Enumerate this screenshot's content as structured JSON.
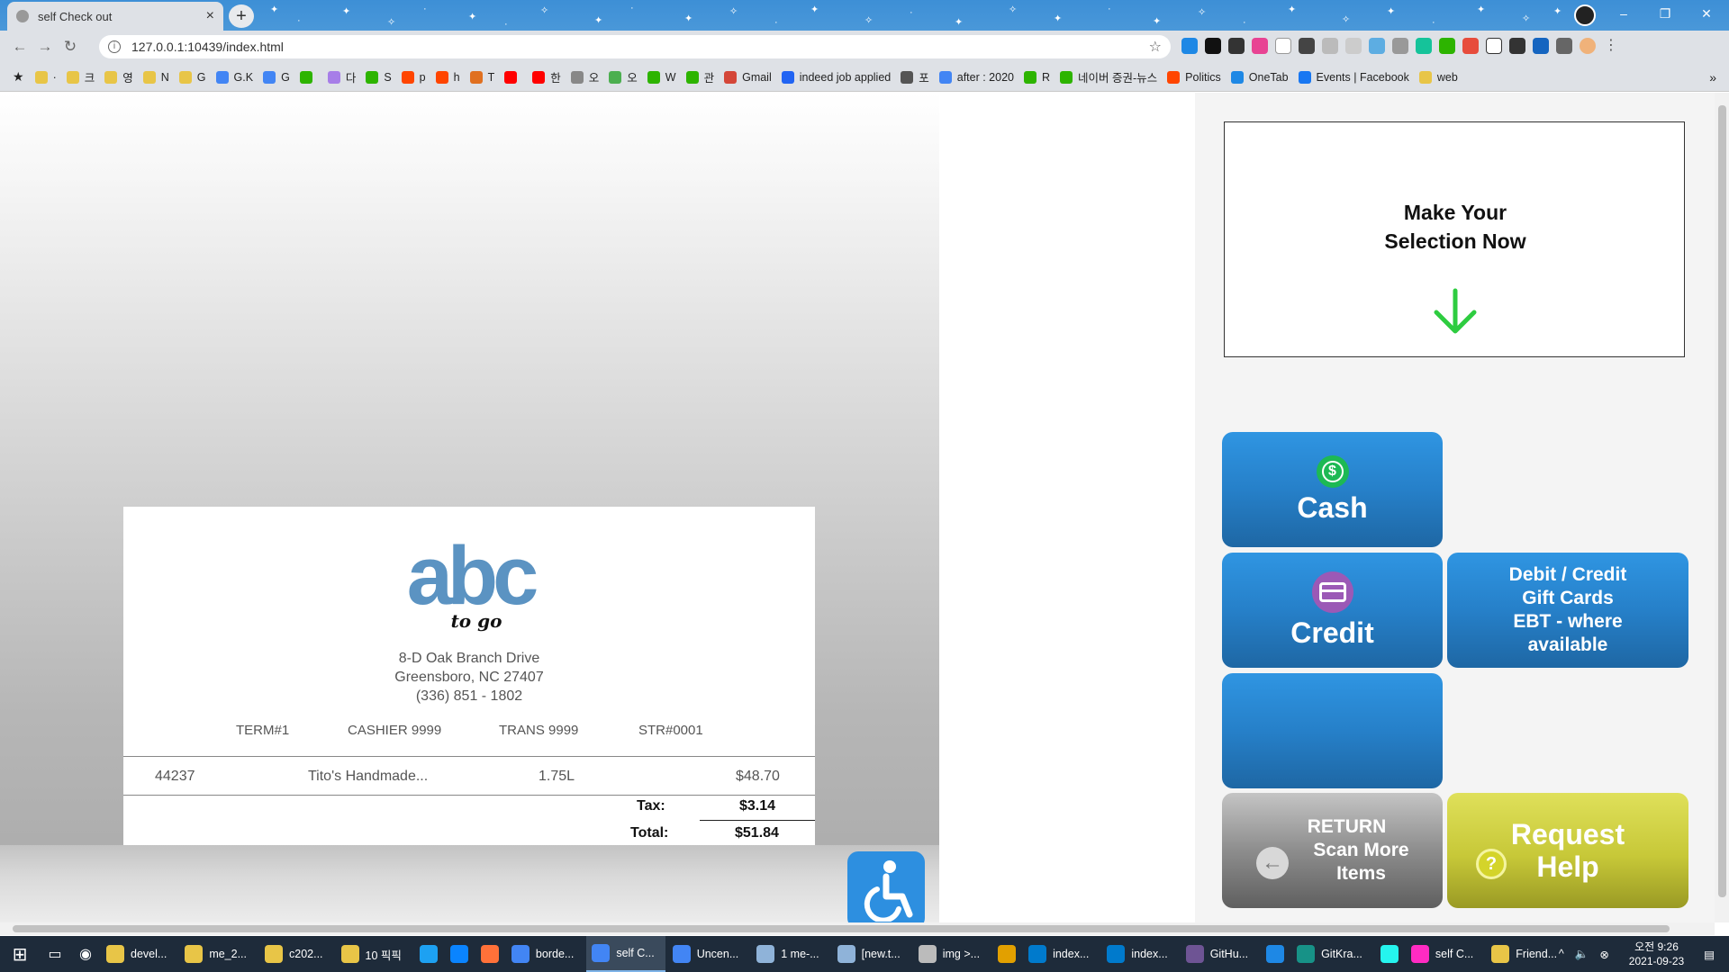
{
  "browser": {
    "tab_title": "self Check out",
    "tab_close": "×",
    "new_tab": "+",
    "url": "127.0.0.1:10439/index.html",
    "win_min": "–",
    "win_max": "❐",
    "win_close": "✕"
  },
  "bookmarks": [
    {
      "label": "·",
      "color": "#e8c547"
    },
    {
      "label": "크",
      "color": "#e8c547"
    },
    {
      "label": "영",
      "color": "#e8c547"
    },
    {
      "label": "N",
      "color": "#e8c547"
    },
    {
      "label": "G",
      "color": "#e8c547"
    },
    {
      "label": "G.K",
      "color": "#4285f4"
    },
    {
      "label": "G",
      "color": "#4285f4"
    },
    {
      "label": "",
      "color": "#2db400"
    },
    {
      "label": "다",
      "color": "#a77ee8"
    },
    {
      "label": "S",
      "color": "#2db400"
    },
    {
      "label": "p",
      "color": "#ff4500"
    },
    {
      "label": "h",
      "color": "#ff4500"
    },
    {
      "label": "T",
      "color": "#e07020"
    },
    {
      "label": "",
      "color": "#ff0000"
    },
    {
      "label": "한",
      "color": "#ff0000"
    },
    {
      "label": "오",
      "color": "#888888"
    },
    {
      "label": "오",
      "color": "#4caf50"
    },
    {
      "label": "W",
      "color": "#2db400"
    },
    {
      "label": "관",
      "color": "#2db400"
    },
    {
      "label": "Gmail",
      "color": "#d44638"
    },
    {
      "label": "indeed job applied",
      "color": "#2164f3"
    },
    {
      "label": "포",
      "color": "#555555"
    },
    {
      "label": "after : 2020",
      "color": "#4285f4"
    },
    {
      "label": "R",
      "color": "#2db400"
    },
    {
      "label": "네이버 증권-뉴스",
      "color": "#2db400"
    },
    {
      "label": "Politics",
      "color": "#ff4500"
    },
    {
      "label": "OneTab",
      "color": "#1e88e5"
    },
    {
      "label": "Events | Facebook",
      "color": "#1877f2"
    },
    {
      "label": "web",
      "color": "#e8c547"
    }
  ],
  "bookmarks_more": "»",
  "receipt": {
    "logo_main": "abc",
    "logo_sub": "to go",
    "address_line1": "8-D Oak Branch Drive",
    "address_line2": "Greensboro, NC 27407",
    "address_line3": "(336) 851 - 1802",
    "term": "TERM#1",
    "cashier": "CASHIER 9999",
    "trans": "TRANS 9999",
    "store": "STR#0001",
    "items": [
      {
        "code": "44237",
        "name": "Tito's Handmade...",
        "size": "1.75L",
        "price": "$48.70"
      }
    ],
    "tax_label": "Tax:",
    "tax_value": "$3.14",
    "total_label": "Total:",
    "total_value": "$51.84"
  },
  "prompt": {
    "line1": "Make Your",
    "line2": "Selection Now",
    "arrow_color": "#2ecc40"
  },
  "buttons": {
    "cash": "Cash",
    "credit": "Credit",
    "debit_l1": "Debit / Credit",
    "debit_l2": "Gift Cards",
    "debit_l3": "EBT - where",
    "debit_l4": "available",
    "return_l1": "RETURN",
    "return_l2": "Scan More",
    "return_l3": "Items",
    "help_l1": "Request",
    "help_l2": "Help",
    "cash_icon": "$",
    "help_icon": "?"
  },
  "colors": {
    "tile_blue": "#2680c9",
    "tile_gray": "#8d8d8d",
    "tile_olive": "#c7c838",
    "cash_icon": "#1db954",
    "credit_icon": "#9b59b6",
    "help_icon": "#d4d42a"
  },
  "taskbar": {
    "items": [
      {
        "label": "devel...",
        "color": "#e8c547"
      },
      {
        "label": "me_2...",
        "color": "#e8c547"
      },
      {
        "label": "c202...",
        "color": "#e8c547"
      },
      {
        "label": "10 픽픽",
        "color": "#e8c547"
      },
      {
        "label": "",
        "color": "#1da1f2"
      },
      {
        "label": "",
        "color": "#0a84ff"
      },
      {
        "label": "",
        "color": "#ff7139"
      },
      {
        "label": "borde...",
        "color": "#4285f4"
      },
      {
        "label": "self C...",
        "color": "#4285f4",
        "active": true
      },
      {
        "label": "Uncen...",
        "color": "#4285f4"
      },
      {
        "label": "1 me-...",
        "color": "#8fb3d9"
      },
      {
        "label": "[new.t...",
        "color": "#8fb3d9"
      },
      {
        "label": "img >...",
        "color": "#bbbbbb"
      },
      {
        "label": "",
        "color": "#e2a000"
      },
      {
        "label": "index...",
        "color": "#007acc"
      },
      {
        "label": "index...",
        "color": "#007acc"
      },
      {
        "label": "GitHu...",
        "color": "#6e5494"
      },
      {
        "label": "",
        "color": "#1e88e5"
      },
      {
        "label": "GitKra...",
        "color": "#179287"
      },
      {
        "label": "",
        "color": "#25f4ee"
      },
      {
        "label": "self C...",
        "color": "#ff2bc2"
      },
      {
        "label": "Friend...",
        "color": "#e8c547"
      }
    ],
    "time": "오전 9:26",
    "date": "2021-09-23"
  }
}
